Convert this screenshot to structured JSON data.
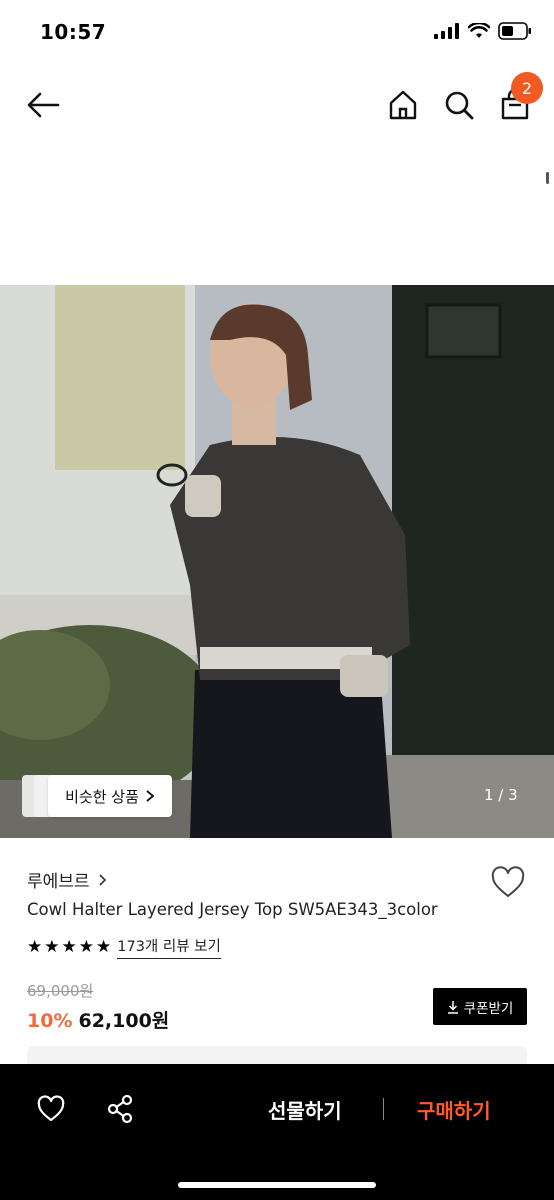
{
  "status": {
    "time": "10:57",
    "battery_icon": "battery-icon",
    "wifi_icon": "wifi-icon",
    "signal_icon": "cellular-signal-icon"
  },
  "header": {
    "cart_count": "2"
  },
  "gallery": {
    "similar_label": "비슷한 상품",
    "counter": "1 / 3"
  },
  "product": {
    "brand": "루에브르",
    "name": "Cowl Halter Layered Jersey Top SW5AE343_3color",
    "rating_stars": 5,
    "review_label": "173개 리뷰 보기",
    "original_price": "69,000원",
    "discount": "10%",
    "sale_price": "62,100원",
    "coupon_label": "쿠폰받기"
  },
  "bottom_bar": {
    "gift_label": "선물하기",
    "buy_label": "구매하기"
  },
  "colors": {
    "accent": "#f15a22",
    "discount": "#f26b3a",
    "buy": "#ff5a2c"
  }
}
